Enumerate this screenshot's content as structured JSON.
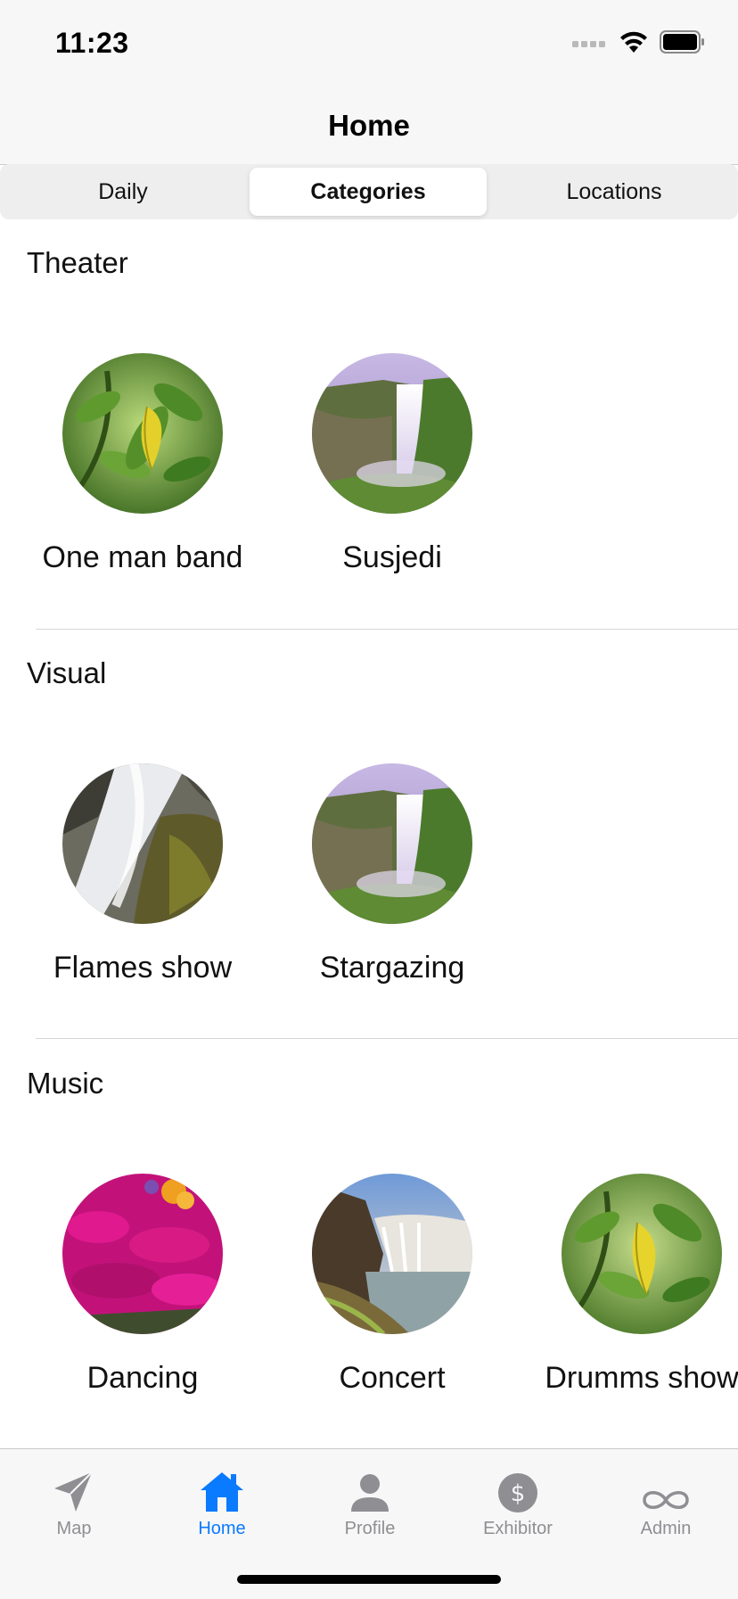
{
  "status_bar": {
    "time": "11:23"
  },
  "nav": {
    "title": "Home"
  },
  "segments": [
    {
      "label": "Daily"
    },
    {
      "label": "Categories"
    },
    {
      "label": "Locations"
    }
  ],
  "sections": [
    {
      "title": "Theater",
      "items": [
        {
          "label": "One man band"
        },
        {
          "label": "Susjedi"
        }
      ]
    },
    {
      "title": "Visual",
      "items": [
        {
          "label": "Flames show"
        },
        {
          "label": "Stargazing"
        }
      ]
    },
    {
      "title": "Music",
      "items": [
        {
          "label": "Dancing"
        },
        {
          "label": "Concert"
        },
        {
          "label": "Drumms show"
        }
      ]
    }
  ],
  "tab_bar": {
    "items": [
      {
        "label": "Map",
        "icon": "paper-plane-icon"
      },
      {
        "label": "Home",
        "icon": "house-icon"
      },
      {
        "label": "Profile",
        "icon": "person-icon"
      },
      {
        "label": "Exhibitor",
        "icon": "dollar-circle-icon"
      },
      {
        "label": "Admin",
        "icon": "infinity-icon"
      }
    ],
    "active_index": 1
  },
  "colors": {
    "accent": "#0a7aff",
    "inactive": "#8e8e93"
  }
}
